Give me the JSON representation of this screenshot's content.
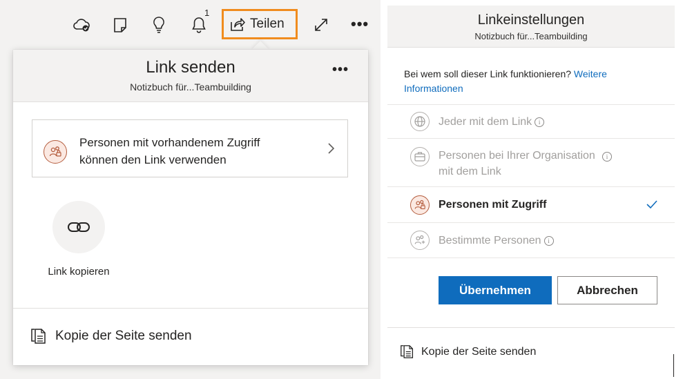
{
  "toolbar": {
    "notification_count": "1",
    "share_label": "Teilen",
    "icons": [
      "cloud-sync-icon",
      "notebook-page-icon",
      "lightbulb-icon",
      "bell-icon",
      "share-icon",
      "expand-icon",
      "more-icon"
    ],
    "more_label": "•••"
  },
  "popup": {
    "title": "Link senden",
    "subtitle": "Notizbuch für...Teambuilding",
    "more_label": "•••",
    "access_option": "Personen mit vorhandenem Zugriff können den Link verwenden",
    "copy_link_label": "Link kopieren",
    "send_copy_label": "Kopie der Seite senden"
  },
  "link_settings": {
    "title": "Linkeinstellungen",
    "subtitle": "Notizbuch für...Teambuilding",
    "question": "Bei wem soll dieser Link funktionieren?",
    "more_info_link": "Weitere Informationen",
    "options": [
      {
        "label": "Jeder mit dem Link",
        "enabled": false,
        "selected": false
      },
      {
        "label": "Personen bei Ihrer Organisation mit dem Link",
        "enabled": false,
        "selected": false
      },
      {
        "label": "Personen mit Zugriff",
        "enabled": true,
        "selected": true
      },
      {
        "label": "Bestimmte Personen",
        "enabled": false,
        "selected": false
      }
    ],
    "info_glyph": "i",
    "apply_label": "Übernehmen",
    "cancel_label": "Abbrechen",
    "send_copy_label": "Kopie der Seite senden"
  },
  "colors": {
    "accent": "#0f6cbd",
    "highlight_border": "#f08c1e",
    "avatar_border": "#b45c3d",
    "disabled_text": "#a19f9d"
  }
}
